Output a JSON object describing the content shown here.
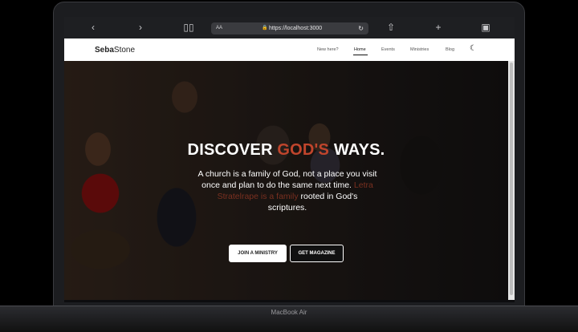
{
  "device": {
    "label": "MacBook Air"
  },
  "browser": {
    "url": "https://localhost:3000",
    "aa_label": "AA"
  },
  "site": {
    "brand_prefix": "Seba",
    "brand_suffix": "Stone",
    "nav": [
      {
        "label": "New here?"
      },
      {
        "label": "Home",
        "active": true
      },
      {
        "label": "Events"
      },
      {
        "label": "Ministries"
      },
      {
        "label": "Blog"
      }
    ],
    "hero": {
      "headline_1": "DISCOVER",
      "headline_highlight": "GOD'S",
      "headline_2": "WAYS.",
      "text_line_1": "A church is a family of God, not a place you visit",
      "text_line_2": "once and plan to do the same next time.",
      "text_muted": "Letra Stratelrape is a family",
      "text_line_3": "rooted in God's",
      "text_line_4": "scriptures.",
      "button_primary": "JOIN A MINISTRY",
      "button_secondary": "GET MAGAZINE"
    }
  }
}
